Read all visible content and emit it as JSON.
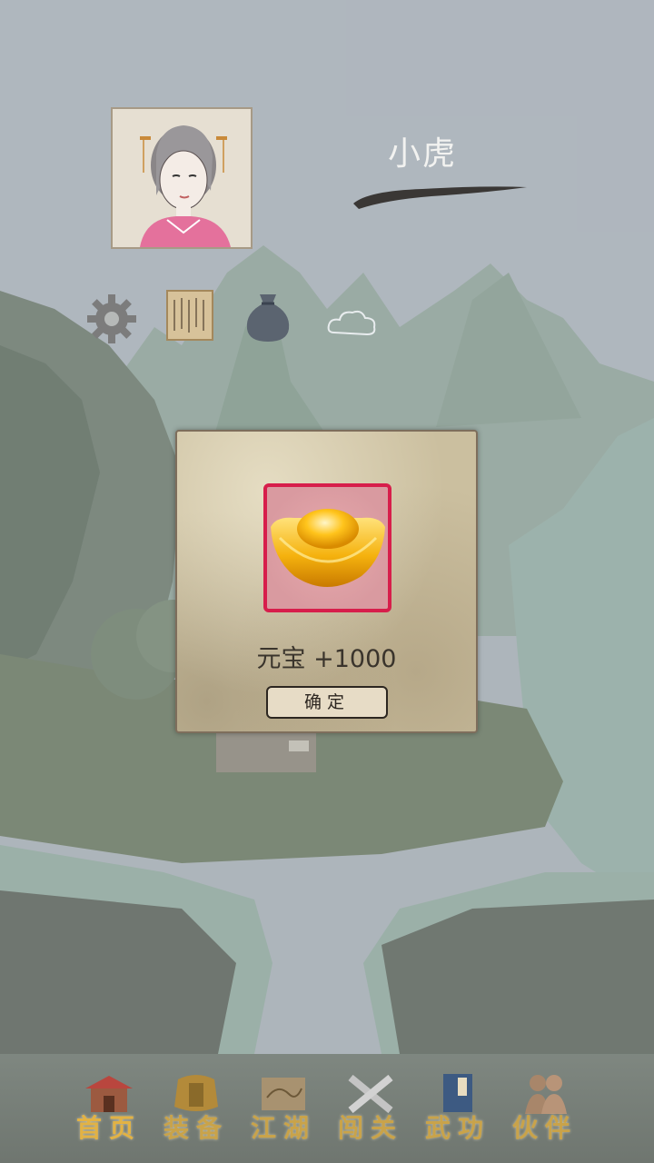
{
  "player": {
    "name": "小虎"
  },
  "top_icons": [
    "gear-icon",
    "scroll-icon",
    "money-bag-icon",
    "cloud-icon"
  ],
  "reward_dialog": {
    "item_icon": "gold-ingot-icon",
    "reward_text": "元宝 +1000",
    "confirm_label": "确定",
    "frame_color": "#d71e4b"
  },
  "bottom_nav": [
    {
      "label": "首页",
      "icon": "house-icon",
      "active": true
    },
    {
      "label": "装备",
      "icon": "armor-icon"
    },
    {
      "label": "江湖",
      "icon": "map-scroll-icon"
    },
    {
      "label": "闯关",
      "icon": "crossed-swords-icon"
    },
    {
      "label": "武功",
      "icon": "book-icon"
    },
    {
      "label": "伙伴",
      "icon": "companions-icon"
    }
  ],
  "colors": {
    "accent_gold": "#c9a34a",
    "text_dark": "#3a342c"
  }
}
